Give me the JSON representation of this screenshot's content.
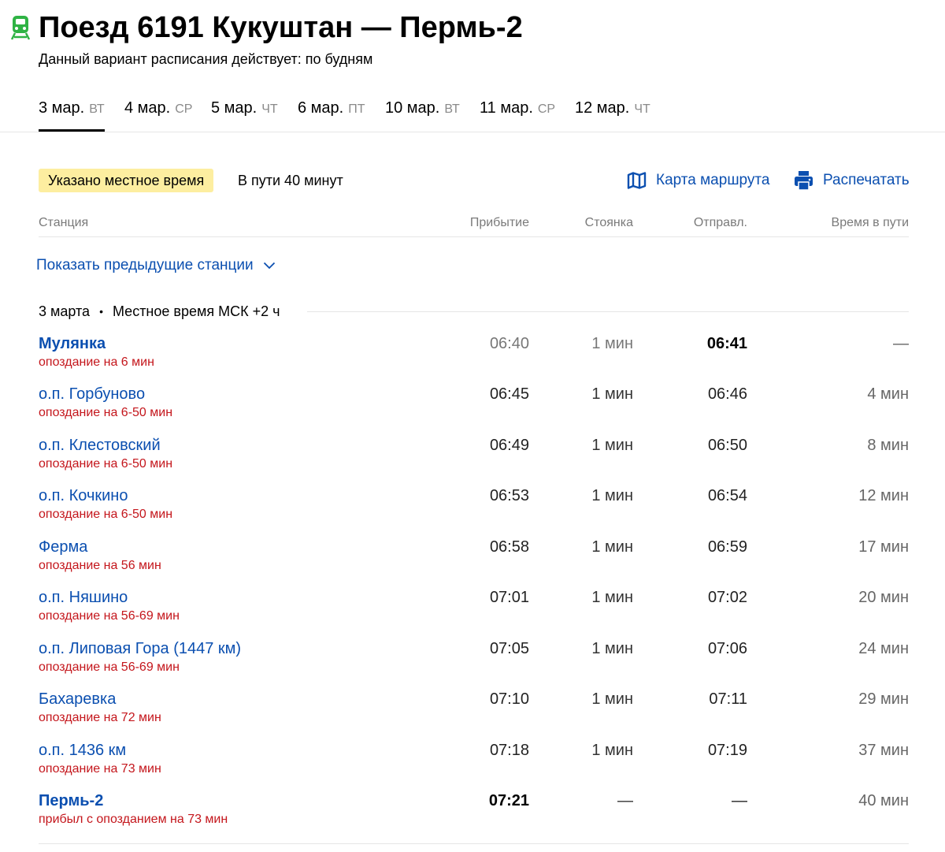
{
  "header": {
    "title": "Поезд 6191 Кукуштан — Пермь-2",
    "subtitle": "Данный вариант расписания действует: по будням"
  },
  "tabs": [
    {
      "date": "3 мар.",
      "weekday": "вт",
      "active": true
    },
    {
      "date": "4 мар.",
      "weekday": "ср",
      "active": false
    },
    {
      "date": "5 мар.",
      "weekday": "чт",
      "active": false
    },
    {
      "date": "6 мар.",
      "weekday": "пт",
      "active": false
    },
    {
      "date": "10 мар.",
      "weekday": "вт",
      "active": false
    },
    {
      "date": "11 мар.",
      "weekday": "ср",
      "active": false
    },
    {
      "date": "12 мар.",
      "weekday": "чт",
      "active": false
    }
  ],
  "info": {
    "badge": "Указано местное время",
    "duration": "В пути 40 минут",
    "map_link": "Карта маршрута",
    "print_link": "Распечатать"
  },
  "columns": {
    "station": "Станция",
    "arrival": "Прибытие",
    "stop": "Стоянка",
    "departure": "Отправл.",
    "travel": "Время в пути"
  },
  "show_previous": "Показать предыдущие станции",
  "date_line": {
    "date": "3 марта",
    "tz": "Местное время МСК +2 ч"
  },
  "stations": [
    {
      "name": "Мулянка",
      "note": "опоздание на 6 мин",
      "arrival": "06:40",
      "stop": "1 мин",
      "departure": "06:41",
      "travel": "—"
    },
    {
      "name": "о.п. Горбуново",
      "note": "опоздание на 6-50 мин",
      "arrival": "06:45",
      "stop": "1 мин",
      "departure": "06:46",
      "travel": "4 мин"
    },
    {
      "name": "о.п. Клестовский",
      "note": "опоздание на 6-50 мин",
      "arrival": "06:49",
      "stop": "1 мин",
      "departure": "06:50",
      "travel": "8 мин"
    },
    {
      "name": "о.п. Кочкино",
      "note": "опоздание на 6-50 мин",
      "arrival": "06:53",
      "stop": "1 мин",
      "departure": "06:54",
      "travel": "12 мин"
    },
    {
      "name": "Ферма",
      "note": "опоздание на 56 мин",
      "arrival": "06:58",
      "stop": "1 мин",
      "departure": "06:59",
      "travel": "17 мин"
    },
    {
      "name": "о.п. Няшино",
      "note": "опоздание на 56-69 мин",
      "arrival": "07:01",
      "stop": "1 мин",
      "departure": "07:02",
      "travel": "20 мин"
    },
    {
      "name": "о.п. Липовая Гора (1447 км)",
      "note": "опоздание на 56-69 мин",
      "arrival": "07:05",
      "stop": "1 мин",
      "departure": "07:06",
      "travel": "24 мин"
    },
    {
      "name": "Бахаревка",
      "note": "опоздание на 72 мин",
      "arrival": "07:10",
      "stop": "1 мин",
      "departure": "07:11",
      "travel": "29 мин"
    },
    {
      "name": "о.п. 1436 км",
      "note": "опоздание на 73 мин",
      "arrival": "07:18",
      "stop": "1 мин",
      "departure": "07:19",
      "travel": "37 мин"
    },
    {
      "name": "Пермь-2",
      "note": "прибыл с опозданием на 73 мин",
      "arrival": "07:21",
      "stop": "—",
      "departure": "—",
      "travel": "40 мин"
    }
  ],
  "colors": {
    "link": "#0b4fb0",
    "delay": "#c4161c",
    "badge_bg": "#fdeea0",
    "train_icon": "#2fb344"
  }
}
